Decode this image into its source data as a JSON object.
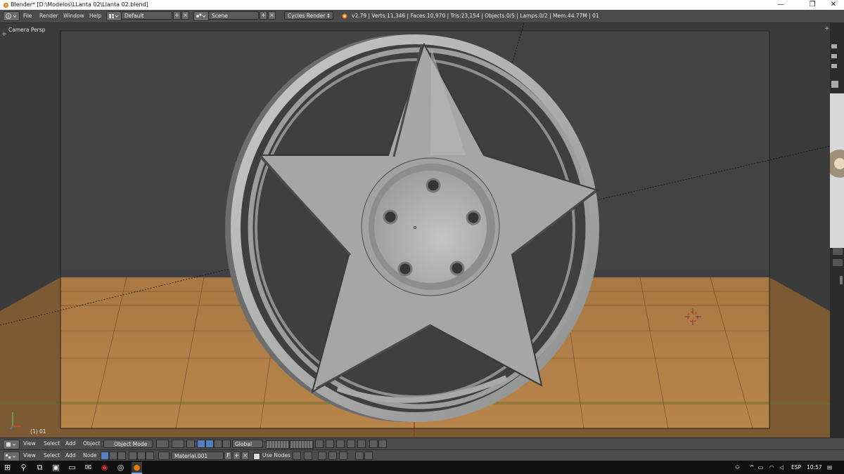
{
  "window": {
    "title": "Blender* [D:\\Modelos\\LLanta 02\\Llanta 02.blend]",
    "controls": {
      "minimize": "—",
      "maximize": "❐",
      "close": "✕"
    }
  },
  "info_header": {
    "menus": [
      "File",
      "Render",
      "Window",
      "Help"
    ],
    "layout": "Default",
    "scene": "Scene",
    "engine": "Cycles Render",
    "stats": "v2.79 | Verts:11,346 | Faces:10,970 | Tris:23,154 | Objects:0/5 | Lamps:0/2 | Mem:44.77M | 01"
  },
  "viewport": {
    "view_label": "Camera Persp",
    "frame_label": "(1) 01"
  },
  "view3d_header": {
    "menus": [
      "View",
      "Select",
      "Add",
      "Object"
    ],
    "mode": "Object Mode",
    "orientation": "Global"
  },
  "node_header": {
    "menus": [
      "View",
      "Select",
      "Add",
      "Node"
    ],
    "material": "Material.001",
    "fake_user": "F",
    "use_nodes": "Use Nodes"
  },
  "taskbar": {
    "language": "ESP",
    "time": "10:57"
  },
  "colors": {
    "floor": "#b8854b",
    "background": "#404040",
    "wheel": "#b0b0b0"
  }
}
